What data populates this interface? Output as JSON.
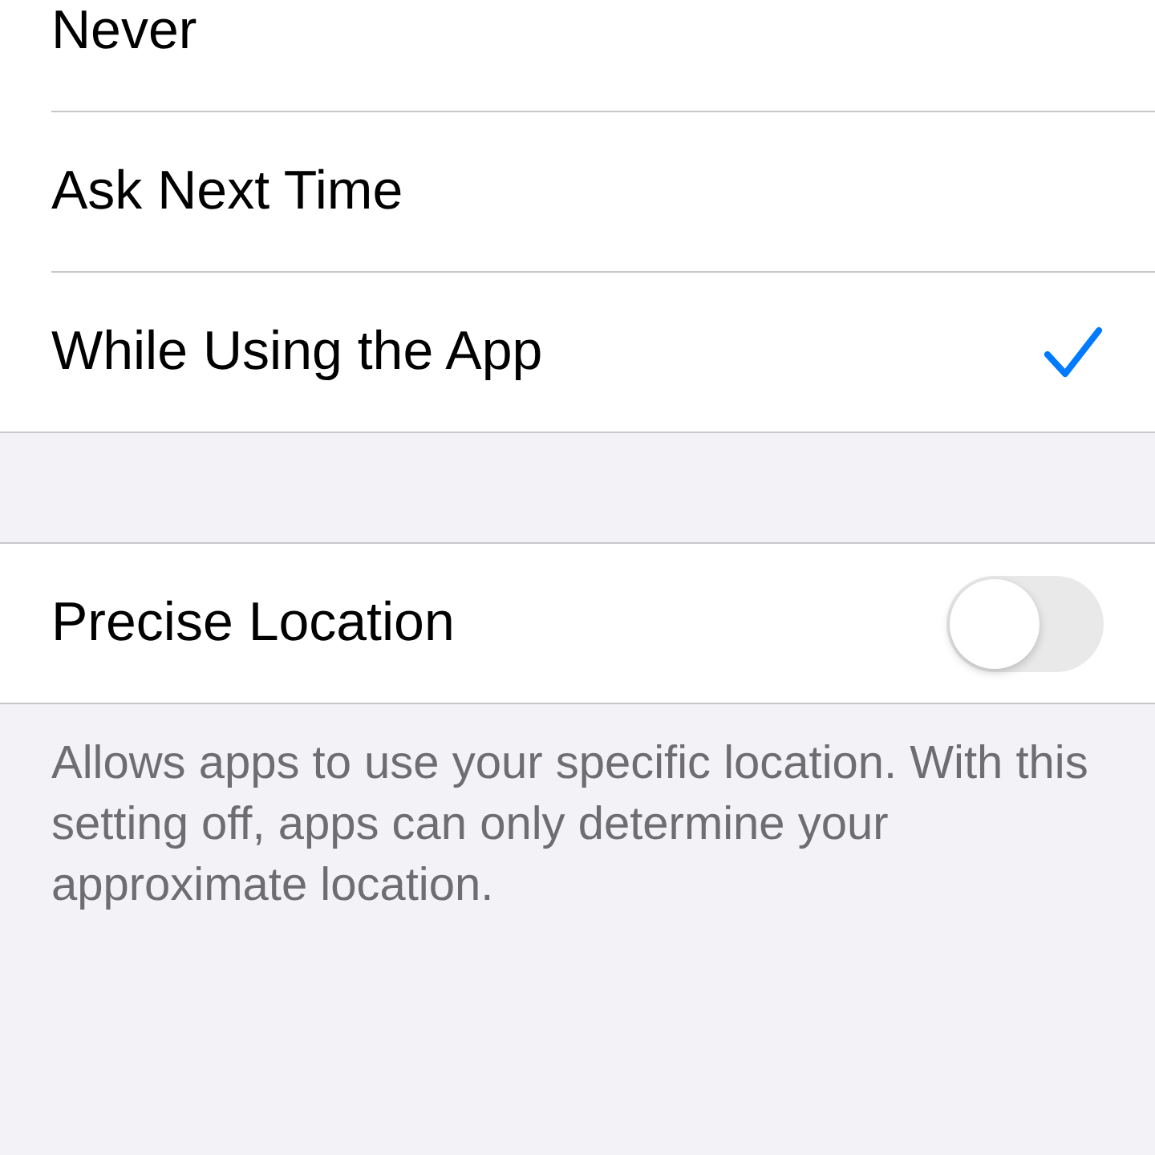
{
  "options": [
    {
      "label": "Never",
      "selected": false
    },
    {
      "label": "Ask Next Time",
      "selected": false
    },
    {
      "label": "While Using the App",
      "selected": true
    }
  ],
  "precise_location": {
    "label": "Precise Location",
    "on": false
  },
  "footer": "Allows apps to use your specific location. With this setting off, apps can only determine your approximate location."
}
